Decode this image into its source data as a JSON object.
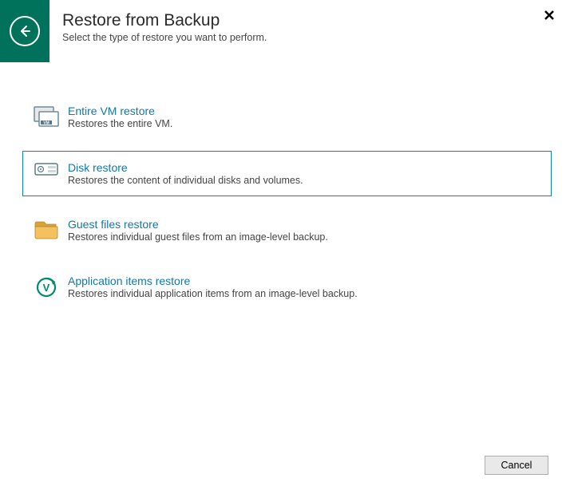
{
  "header": {
    "title": "Restore from Backup",
    "subtitle": "Select the type of restore you want to perform."
  },
  "options": [
    {
      "title": "Entire VM restore",
      "desc": "Restores the entire VM.",
      "selected": false,
      "icon": "vm"
    },
    {
      "title": "Disk restore",
      "desc": "Restores the content of individual disks and volumes.",
      "selected": true,
      "icon": "disk"
    },
    {
      "title": "Guest files restore",
      "desc": "Restores individual guest files from an image-level backup.",
      "selected": false,
      "icon": "folder"
    },
    {
      "title": "Application items restore",
      "desc": "Restores individual application items from an image-level backup.",
      "selected": false,
      "icon": "app"
    }
  ],
  "footer": {
    "cancel": "Cancel"
  }
}
